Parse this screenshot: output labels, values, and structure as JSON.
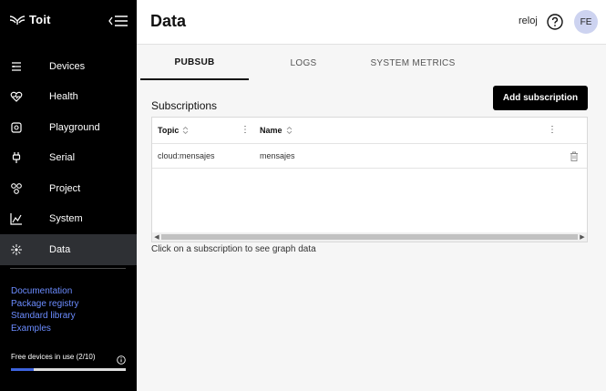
{
  "app": {
    "brand": "Toit"
  },
  "sidebar": {
    "items": [
      {
        "label": "Devices",
        "icon": "devices-icon"
      },
      {
        "label": "Health",
        "icon": "health-icon"
      },
      {
        "label": "Playground",
        "icon": "playground-icon"
      },
      {
        "label": "Serial",
        "icon": "serial-icon"
      },
      {
        "label": "Project",
        "icon": "project-icon"
      },
      {
        "label": "System",
        "icon": "system-icon"
      },
      {
        "label": "Data",
        "icon": "data-icon",
        "active": true
      }
    ],
    "links": [
      "Documentation",
      "Package registry",
      "Standard library",
      "Examples"
    ],
    "free_devices": {
      "label": "Free devices in use (2/10)",
      "used": 2,
      "total": 10
    }
  },
  "header": {
    "title": "Data",
    "device": "reloj",
    "avatar": "FE"
  },
  "tabs": [
    {
      "label": "PUBSUB",
      "active": true
    },
    {
      "label": "LOGS"
    },
    {
      "label": "SYSTEM METRICS"
    }
  ],
  "subscriptions": {
    "title": "Subscriptions",
    "add_label": "Add subscription",
    "columns": [
      "Topic",
      "Name"
    ],
    "rows": [
      {
        "topic": "cloud:mensajes",
        "name": "mensajes"
      }
    ],
    "hint": "Click on a subscription to see graph data"
  },
  "colors": {
    "sidebar_bg": "#000000",
    "active_item": "#2e3034",
    "link": "#6b8cff",
    "accent": "#3d63dd",
    "avatar_bg": "#cdd3f0"
  }
}
